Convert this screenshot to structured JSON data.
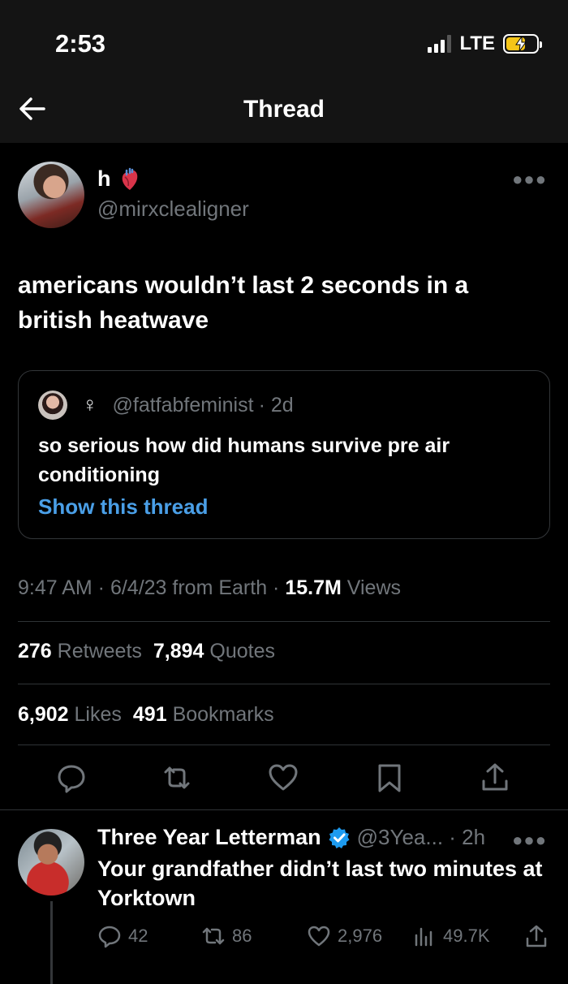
{
  "status_bar": {
    "time": "2:53",
    "network": "LTE",
    "battery_color": "#f5c518"
  },
  "nav": {
    "title": "Thread"
  },
  "tweet": {
    "author_name": "h",
    "author_emoji": "anatomical-heart",
    "author_handle": "@mirxclealigner",
    "text": "americans wouldn’t last 2 seconds in a british heatwave",
    "quote": {
      "symbol": "♀",
      "handle": "@fatfabfeminist",
      "time": "· 2d",
      "text": "so serious how did humans survive pre air conditioning",
      "show_thread": "Show this thread"
    },
    "meta": {
      "datetime": "9:47 AM · 6/4/23 from Earth ·",
      "views_count": "15.7M",
      "views_label": "Views"
    },
    "stats": {
      "retweets_count": "276",
      "retweets_label": "Retweets",
      "quotes_count": "7,894",
      "quotes_label": "Quotes",
      "likes_count": "6,902",
      "likes_label": "Likes",
      "bookmarks_count": "491",
      "bookmarks_label": "Bookmarks"
    }
  },
  "reply": {
    "author_name": "Three Year Letterman",
    "verified": true,
    "handle_time": "@3Yea... · 2h",
    "text": "Your grandfather didn’t last two minutes at Yorktown",
    "replies": "42",
    "retweets": "86",
    "likes": "2,976",
    "views": "49.7K"
  },
  "colors": {
    "accent": "#4a9fe7",
    "muted": "#71767b",
    "verified": "#1d9bf0"
  }
}
